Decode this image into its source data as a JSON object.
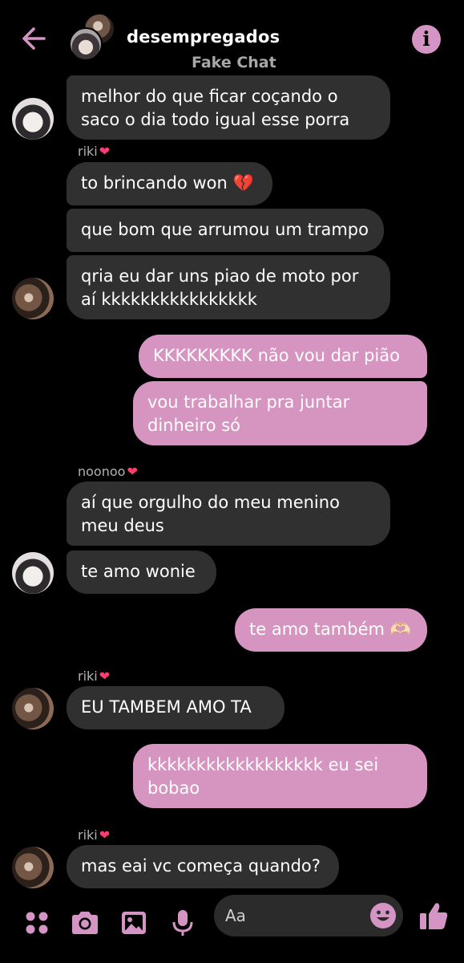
{
  "header": {
    "title": "desempregados",
    "subtitle": "Fake Chat",
    "back_icon": "arrow-left-icon",
    "info_icon": "info-icon",
    "info_symbol": "i"
  },
  "messages": [
    {
      "sender": "",
      "direction": "in",
      "text": "melhor do que ficar coçando o\nsaco o dia todo igual esse porra"
    },
    {
      "sender": "riki",
      "direction": "in",
      "text": "to brincando won 💔"
    },
    {
      "sender": "",
      "direction": "in",
      "text": "que bom que arrumou um trampo"
    },
    {
      "sender": "",
      "direction": "in",
      "text": "qria eu dar uns piao de moto por\naí kkkkkkkkkkkkkkkk"
    },
    {
      "sender": "",
      "direction": "out",
      "text": "KKKKKKKKK não vou dar pião"
    },
    {
      "sender": "",
      "direction": "out",
      "text": "vou trabalhar pra juntar\ndinheiro só"
    },
    {
      "sender": "noonoo",
      "direction": "in",
      "text": "aí que orgulho do meu menino\nmeu deus"
    },
    {
      "sender": "",
      "direction": "in",
      "text": "te amo wonie"
    },
    {
      "sender": "",
      "direction": "out",
      "text": "te amo também 🫶🏻"
    },
    {
      "sender": "riki",
      "direction": "in",
      "text": "EU TAMBEM AMO TA"
    },
    {
      "sender": "",
      "direction": "out",
      "text": "kkkkkkkkkkkkkkkkkk eu sei\nbobao"
    },
    {
      "sender": "riki",
      "direction": "in",
      "text": "mas eai vc começa quando?"
    }
  ],
  "senders": {
    "heart": "❤"
  },
  "composer": {
    "placeholder": "Aa",
    "icons": [
      "menu-dots-icon",
      "camera-icon",
      "gallery-icon",
      "microphone-icon",
      "emoji-icon",
      "thumbs-up-icon"
    ]
  },
  "colors": {
    "accent": "#d494c4",
    "incoming_bubble": "#303030",
    "outgoing_bubble": "#d694c1",
    "background": "#000000",
    "heart": "#ff3c72"
  }
}
